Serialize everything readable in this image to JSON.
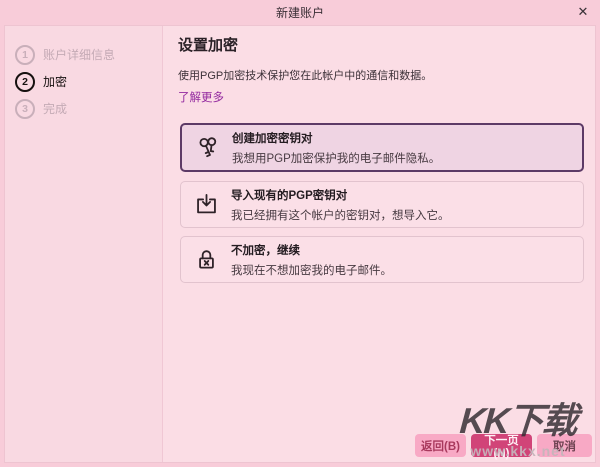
{
  "window": {
    "title": "新建账户",
    "close_icon": "✕"
  },
  "steps": [
    {
      "number": "1",
      "label": "账户详细信息",
      "state": "inactive"
    },
    {
      "number": "2",
      "label": "加密",
      "state": "active"
    },
    {
      "number": "3",
      "label": "完成",
      "state": "inactive"
    }
  ],
  "content": {
    "heading": "设置加密",
    "description": "使用PGP加密技术保护您在此帐户中的通信和数据。",
    "learn_more": "了解更多",
    "options": [
      {
        "icon": "keys-icon",
        "title": "创建加密密钥对",
        "subtitle": "我想用PGP加密保护我的电子邮件隐私。",
        "selected": true
      },
      {
        "icon": "import-icon",
        "title": "导入现有的PGP密钥对",
        "subtitle": "我已经拥有这个帐户的密钥对，想导入它。",
        "selected": false
      },
      {
        "icon": "lock-x-icon",
        "title": "不加密，继续",
        "subtitle": "我现在不想加密我的电子邮件。",
        "selected": false
      }
    ]
  },
  "footer": {
    "back_label": "返回(B)",
    "next_label": "下一页(N)",
    "cancel_label": "取消"
  },
  "watermark": {
    "logo": "KK下载",
    "url": "www.kkx.net"
  },
  "colors": {
    "frame_pink": "#f8ccd9",
    "panel_pink": "#fbdde5",
    "selected_card_bg": "#efd4e3",
    "selected_card_border": "#5d3a66",
    "link_purple": "#93299f",
    "primary_button": "#d14478",
    "secondary_button": "#f8a9c5"
  }
}
